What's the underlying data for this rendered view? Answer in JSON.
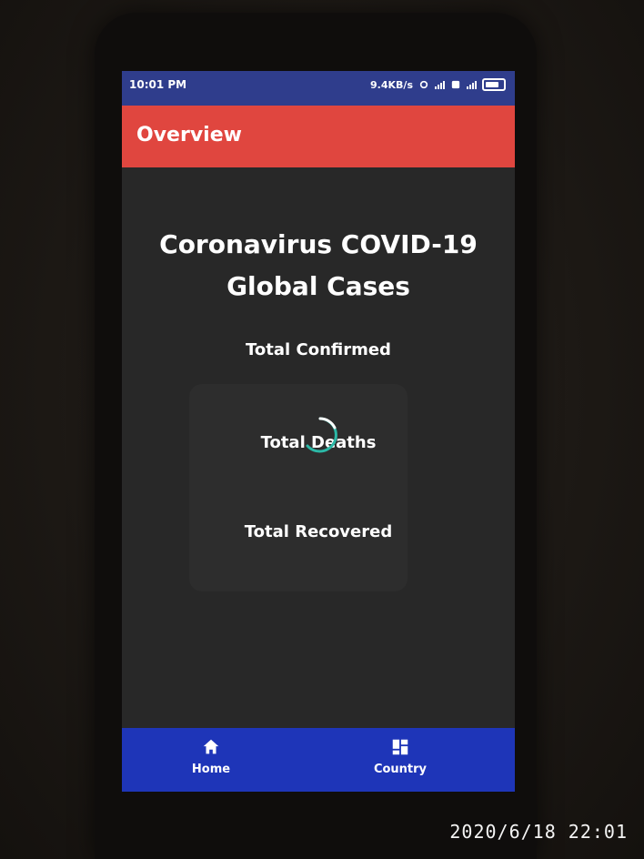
{
  "status_bar": {
    "time": "10:01 PM",
    "network_speed": "9.4KB/s"
  },
  "app_bar": {
    "title": "Overview"
  },
  "headline": {
    "line1": "Coronavirus COVID-19",
    "line2": "Global Cases"
  },
  "stats": {
    "confirmed_label": "Total Confirmed",
    "deaths_label": "Total Deaths",
    "recovered_label": "Total Recovered"
  },
  "bottom_nav": {
    "items": [
      {
        "label": "Home",
        "icon": "home-icon"
      },
      {
        "label": "Country",
        "icon": "dashboard-icon"
      }
    ]
  },
  "photo_timestamp": "2020/6/18  22:01",
  "colors": {
    "status_bar": "#2f3d8c",
    "app_bar": "#e0463f",
    "content_bg": "#282828",
    "bottom_nav": "#1e35b8",
    "spinner": "#2bb8a6"
  }
}
